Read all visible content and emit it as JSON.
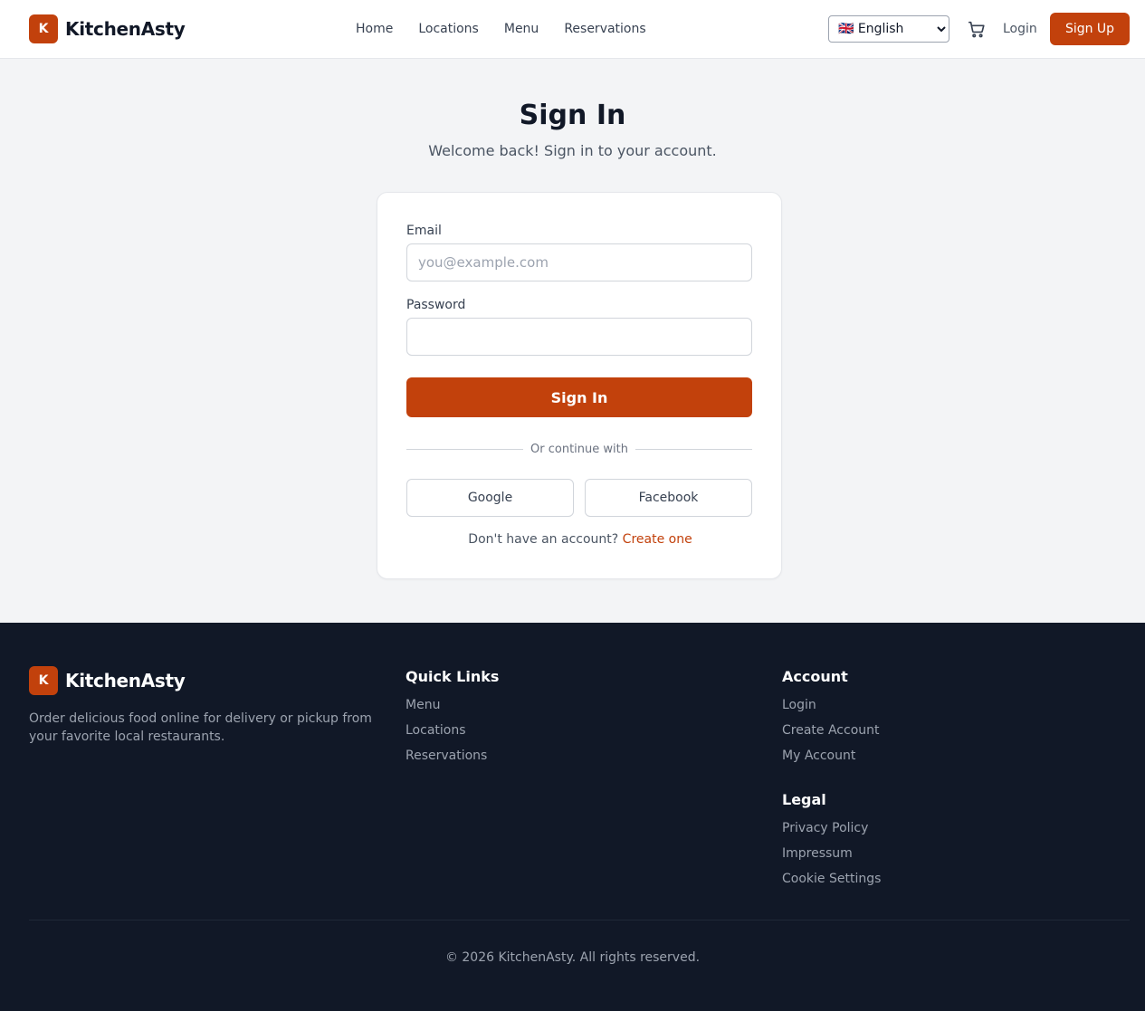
{
  "header": {
    "logo_letter": "K",
    "brand": "KitchenAsty",
    "nav": [
      "Home",
      "Locations",
      "Menu",
      "Reservations"
    ],
    "language": "🇬🇧 English",
    "login": "Login",
    "signup": "Sign Up"
  },
  "main": {
    "title": "Sign In",
    "subtitle": "Welcome back! Sign in to your account.",
    "email_label": "Email",
    "email_placeholder": "you@example.com",
    "password_label": "Password",
    "submit": "Sign In",
    "divider": "Or continue with",
    "google": "Google",
    "facebook": "Facebook",
    "no_account": "Don't have an account?",
    "create_link": "Create one"
  },
  "footer": {
    "logo_letter": "K",
    "brand": "KitchenAsty",
    "description": "Order delicious food online for delivery or pickup from your favorite local restaurants.",
    "quick_links": {
      "title": "Quick Links",
      "items": [
        "Menu",
        "Locations",
        "Reservations"
      ]
    },
    "account": {
      "title": "Account",
      "items": [
        "Login",
        "Create Account",
        "My Account"
      ]
    },
    "legal": {
      "title": "Legal",
      "items": [
        "Privacy Policy",
        "Impressum",
        "Cookie Settings"
      ]
    },
    "copyright": "© 2026 KitchenAsty. All rights reserved."
  },
  "colors": {
    "accent": "#c2410c",
    "footer_bg": "#111827",
    "page_bg": "#f3f4f6"
  },
  "icons": {
    "cart": "shopping-cart-icon"
  }
}
